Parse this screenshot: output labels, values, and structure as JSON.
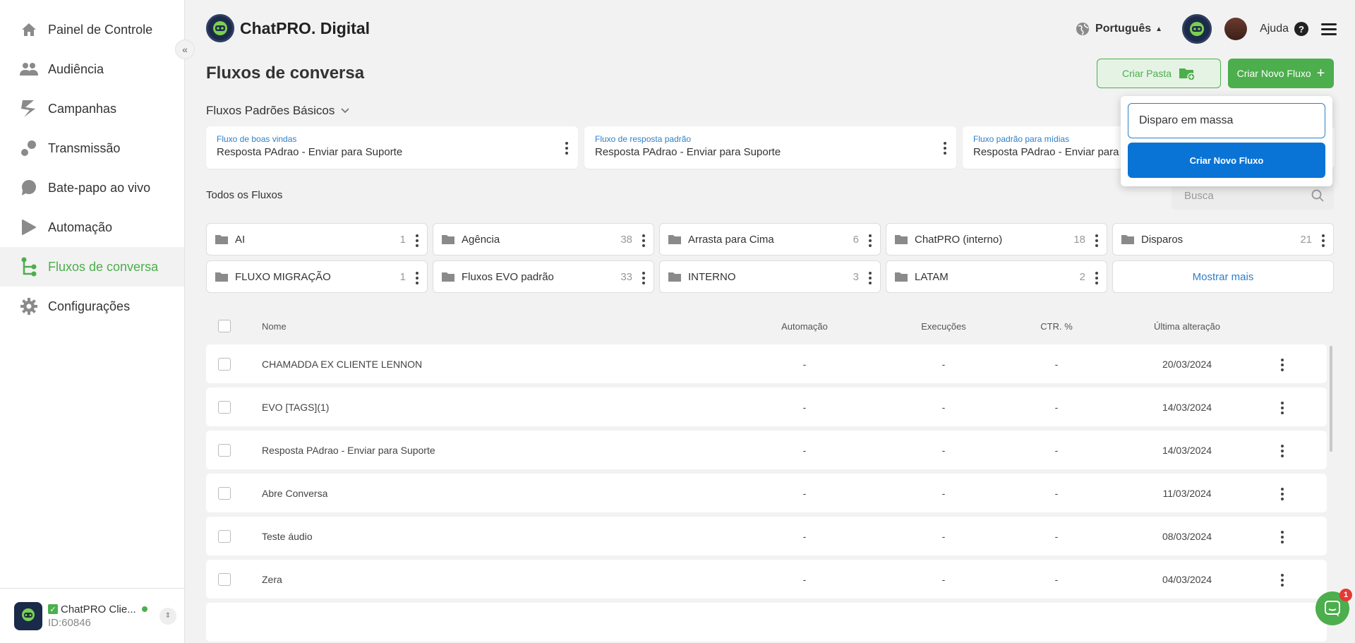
{
  "sidebar": {
    "items": [
      {
        "label": "Painel de Controle",
        "icon": "home-icon"
      },
      {
        "label": "Audiência",
        "icon": "people-icon"
      },
      {
        "label": "Campanhas",
        "icon": "campaign-icon"
      },
      {
        "label": "Transmissão",
        "icon": "broadcast-icon"
      },
      {
        "label": "Bate-papo ao vivo",
        "icon": "chat-icon"
      },
      {
        "label": "Automação",
        "icon": "automation-icon"
      },
      {
        "label": "Fluxos de conversa",
        "icon": "flow-icon",
        "active": true
      },
      {
        "label": "Configurações",
        "icon": "gear-icon"
      }
    ],
    "account": {
      "name": "ChatPRO Clie...",
      "id": "ID:60846",
      "logo_text": "ChatPRO"
    }
  },
  "header": {
    "brand": "ChatPRO. Digital",
    "language": "Português",
    "help": "Ajuda"
  },
  "main": {
    "title": "Fluxos de conversa",
    "create_folder_label": "Criar Pasta",
    "create_flow_label": "Criar Novo Fluxo",
    "basics": {
      "title": "Fluxos Padrões Básicos",
      "cards": [
        {
          "label": "Fluxo de boas vindas",
          "value": "Resposta PAdrao - Enviar para Suporte"
        },
        {
          "label": "Fluxo de resposta padrão",
          "value": "Resposta PAdrao - Enviar para Suporte"
        },
        {
          "label": "Fluxo padrão para mídias",
          "value": "Resposta PAdrao - Enviar para Suporte"
        }
      ]
    },
    "all_title": "Todos os Fluxos",
    "search_placeholder": "Busca",
    "folders": [
      {
        "name": "AI",
        "count": "1"
      },
      {
        "name": "Agência",
        "count": "38"
      },
      {
        "name": "Arrasta para Cima",
        "count": "6"
      },
      {
        "name": "ChatPRO (interno)",
        "count": "18"
      },
      {
        "name": "Disparos",
        "count": "21"
      },
      {
        "name": "FLUXO MIGRAÇÃO",
        "count": "1"
      },
      {
        "name": "Fluxos EVO padrão",
        "count": "33"
      },
      {
        "name": "INTERNO",
        "count": "3"
      },
      {
        "name": "LATAM",
        "count": "2"
      }
    ],
    "show_more": "Mostrar mais",
    "table": {
      "headers": {
        "name": "Nome",
        "automation": "Automação",
        "executions": "Execuções",
        "ctr": "CTR. %",
        "last_change": "Última alteração"
      },
      "rows": [
        {
          "name": "CHAMADDA EX CLIENTE LENNON",
          "automation": "-",
          "executions": "-",
          "ctr": "-",
          "date": "20/03/2024"
        },
        {
          "name": "EVO [TAGS](1)",
          "automation": "-",
          "executions": "-",
          "ctr": "-",
          "date": "14/03/2024"
        },
        {
          "name": "Resposta PAdrao - Enviar para Suporte",
          "automation": "-",
          "executions": "-",
          "ctr": "-",
          "date": "14/03/2024"
        },
        {
          "name": "Abre Conversa",
          "automation": "-",
          "executions": "-",
          "ctr": "-",
          "date": "11/03/2024"
        },
        {
          "name": "Teste áudio",
          "automation": "-",
          "executions": "-",
          "ctr": "-",
          "date": "08/03/2024"
        },
        {
          "name": "Zera",
          "automation": "-",
          "executions": "-",
          "ctr": "-",
          "date": "04/03/2024"
        }
      ]
    }
  },
  "popup": {
    "input_value": "Disparo em massa",
    "button_label": "Criar Novo Fluxo"
  },
  "chat_widget": {
    "badge": "1"
  },
  "colors": {
    "accent_green": "#4cae4c",
    "link_blue": "#2f7fc8",
    "primary_blue": "#0a74d6"
  }
}
